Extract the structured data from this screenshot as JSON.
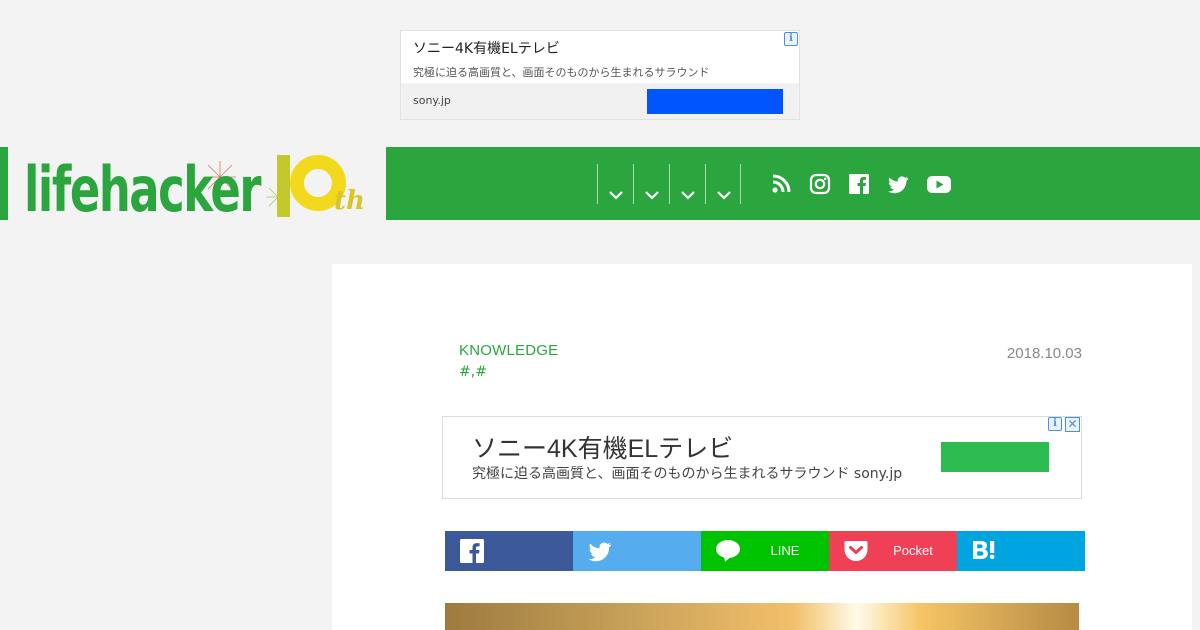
{
  "top_ad": {
    "title": "ソニー4K有機ELテレビ",
    "description": "究極に迫る高画質と、画面そのものから生まれるサラウンド",
    "domain": "sony.jp",
    "cta_color": "#0055ff",
    "info_icon": "info-icon"
  },
  "header": {
    "brand_color": "#2ba53e",
    "logo_text": "lifehacker",
    "logo_anniversary": "10",
    "logo_suffix": "th",
    "dropdown_count": 4,
    "social_icons": [
      "rss-icon",
      "instagram-icon",
      "facebook-icon",
      "twitter-icon",
      "youtube-icon"
    ]
  },
  "article": {
    "category": "KNOWLEDGE",
    "tags": [
      "#",
      "#"
    ],
    "tag_separator": ",",
    "date": "2018.10.03"
  },
  "inline_ad": {
    "title": "ソニー4K有機ELテレビ",
    "description": "究極に迫る高画質と、画面そのものから生まれるサラウンド",
    "domain": "sony.jp",
    "cta_color": "#2bbb51",
    "close_glyph": "✕"
  },
  "share": {
    "facebook": "",
    "twitter": "",
    "line": "LINE",
    "pocket": "Pocket",
    "hatena": ""
  }
}
